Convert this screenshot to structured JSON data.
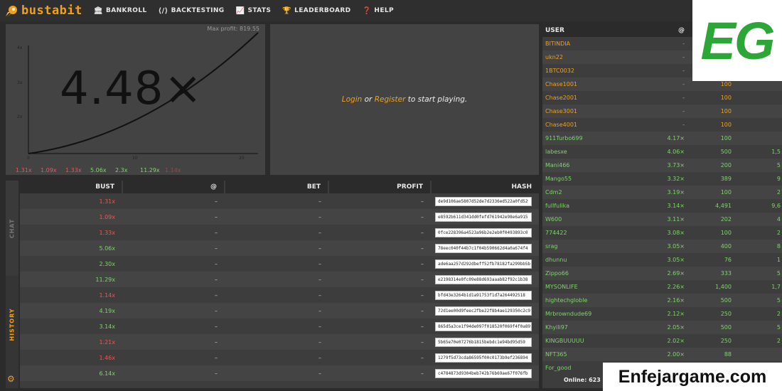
{
  "app": {
    "brand": "bustabit"
  },
  "nav": [
    {
      "label": "BANKROLL",
      "icon": "bank-icon"
    },
    {
      "label": "BACKTESTING",
      "icon": "code-icon"
    },
    {
      "label": "STATS",
      "icon": "chart-icon"
    },
    {
      "label": "LEADERBOARD",
      "icon": "trophy-icon"
    },
    {
      "label": "HELP",
      "icon": "help-icon"
    }
  ],
  "graph": {
    "max_profit": "Max profit: 819.55",
    "multiplier": "4.48×",
    "y_ticks": [
      "4x",
      "3x",
      "2x"
    ],
    "x_ticks": [
      "0",
      "10",
      "20"
    ],
    "recent_busts": [
      {
        "value": "1.31x",
        "color": "red"
      },
      {
        "value": "1.09x",
        "color": "red"
      },
      {
        "value": "1.33x",
        "color": "red"
      },
      {
        "value": "5.06x",
        "color": "green"
      },
      {
        "value": "2.3x",
        "color": "green"
      },
      {
        "value": "11.29x",
        "color": "green"
      },
      {
        "value": "1.14x",
        "color": "red"
      }
    ]
  },
  "play": {
    "login": "Login",
    "or": " or ",
    "register": "Register",
    "rest": " to start playing."
  },
  "side_tabs": {
    "chat": "CHAT",
    "history": "HISTORY"
  },
  "history": {
    "columns": [
      "BUST",
      "@",
      "BET",
      "PROFIT",
      "HASH"
    ],
    "rows": [
      {
        "bust": "1.31x",
        "color": "red",
        "at": "–",
        "bet": "–",
        "profit": "–",
        "hash": "de9d106ae5807d52de7d2336ed522a0fd52"
      },
      {
        "bust": "1.09x",
        "color": "red",
        "at": "–",
        "bet": "–",
        "profit": "–",
        "hash": "e8592b611d341dd0fefd761942e98e6a915"
      },
      {
        "bust": "1.33x",
        "color": "red",
        "at": "–",
        "bet": "–",
        "profit": "–",
        "hash": "0fce228396a4523a96b2e2eb0f0493893c0"
      },
      {
        "bust": "5.06x",
        "color": "green",
        "at": "–",
        "bet": "–",
        "profit": "–",
        "hash": "78eec040f44b7c1f04b590662d4a0a674f4"
      },
      {
        "bust": "2.30x",
        "color": "green",
        "at": "–",
        "bet": "–",
        "profit": "–",
        "hash": "ade6aa257d292dbeff52fb78182fa299bb5b"
      },
      {
        "bust": "11.29x",
        "color": "green",
        "at": "–",
        "bet": "–",
        "profit": "–",
        "hash": "e2198314e0fc09e88d693aaab82f92c1b38"
      },
      {
        "bust": "1.14x",
        "color": "red",
        "at": "–",
        "bet": "–",
        "profit": "–",
        "hash": "bfd43e3264b1d1a91753f1d7a264492518"
      },
      {
        "bust": "4.19x",
        "color": "green",
        "at": "–",
        "bet": "–",
        "profit": "–",
        "hash": "72d1ee00d9feec2fbe22f8b4ae129350c2c9"
      },
      {
        "bust": "3.14x",
        "color": "green",
        "at": "–",
        "bet": "–",
        "profit": "–",
        "hash": "865d5a3ce1f94de097f018520f069f4f0a89f"
      },
      {
        "bust": "1.21x",
        "color": "red",
        "at": "–",
        "bet": "–",
        "profit": "–",
        "hash": "5b65e70e07276b1815bebdc1e94bd95d59"
      },
      {
        "bust": "1.46x",
        "color": "red",
        "at": "–",
        "bet": "–",
        "profit": "–",
        "hash": "1279f5d73cda86595f00c0173b9ef236894"
      },
      {
        "bust": "6.14x",
        "color": "green",
        "at": "–",
        "bet": "–",
        "profit": "–",
        "hash": "c4784873d9304beb742b76b69ae67f076fb"
      }
    ]
  },
  "players": {
    "columns": [
      "USER",
      "@",
      "",
      ""
    ],
    "rows": [
      {
        "user": "BITINDIA",
        "at": "-",
        "bet": "",
        "profit": "",
        "color": "orange"
      },
      {
        "user": "ukn22",
        "at": "-",
        "bet": "",
        "profit": "",
        "color": "orange"
      },
      {
        "user": "1BTC0032",
        "at": "-",
        "bet": "",
        "profit": "",
        "color": "orange"
      },
      {
        "user": "Chase1001",
        "at": "-",
        "bet": "100",
        "profit": "",
        "color": "orange"
      },
      {
        "user": "Chase2001",
        "at": "-",
        "bet": "100",
        "profit": "",
        "color": "orange"
      },
      {
        "user": "Chase3001",
        "at": "-",
        "bet": "100",
        "profit": "",
        "color": "orange"
      },
      {
        "user": "Chase4001",
        "at": "-",
        "bet": "100",
        "profit": "",
        "color": "orange"
      },
      {
        "user": "911Turbo699",
        "at": "4.17×",
        "bet": "100",
        "profit": "",
        "color": "green"
      },
      {
        "user": "labesxe",
        "at": "4.06×",
        "bet": "500",
        "profit": "1,5",
        "color": "green"
      },
      {
        "user": "Mani466",
        "at": "3.73×",
        "bet": "200",
        "profit": "5",
        "color": "green"
      },
      {
        "user": "Mango55",
        "at": "3.32×",
        "bet": "389",
        "profit": "9",
        "color": "green"
      },
      {
        "user": "Cdm2",
        "at": "3.19×",
        "bet": "100",
        "profit": "2",
        "color": "green"
      },
      {
        "user": "fullfulika",
        "at": "3.14×",
        "bet": "4,491",
        "profit": "9,6",
        "color": "green"
      },
      {
        "user": "W600",
        "at": "3.11×",
        "bet": "202",
        "profit": "4",
        "color": "green"
      },
      {
        "user": "774422",
        "at": "3.08×",
        "bet": "100",
        "profit": "2",
        "color": "green"
      },
      {
        "user": "srag",
        "at": "3.05×",
        "bet": "400",
        "profit": "8",
        "color": "green"
      },
      {
        "user": "dhunnu",
        "at": "3.05×",
        "bet": "76",
        "profit": "1",
        "color": "green"
      },
      {
        "user": "Zippo66",
        "at": "2.69×",
        "bet": "333",
        "profit": "5",
        "color": "green"
      },
      {
        "user": "MYSONLIFE",
        "at": "2.26×",
        "bet": "1,400",
        "profit": "1,7",
        "color": "green"
      },
      {
        "user": "hightechgloble",
        "at": "2.16×",
        "bet": "500",
        "profit": "5",
        "color": "green"
      },
      {
        "user": "Mrbrowndude69",
        "at": "2.12×",
        "bet": "250",
        "profit": "2",
        "color": "green"
      },
      {
        "user": "Khyili97",
        "at": "2.05×",
        "bet": "500",
        "profit": "5",
        "color": "green"
      },
      {
        "user": "KINGBUUUUU",
        "at": "2.02×",
        "bet": "250",
        "profit": "2",
        "color": "green"
      },
      {
        "user": "NFT365",
        "at": "2.00×",
        "bet": "88",
        "profit": "",
        "color": "green"
      },
      {
        "user": "For_good",
        "at": "",
        "bet": "",
        "profit": "",
        "color": "green"
      }
    ]
  },
  "online": "Online: 623",
  "overlays": {
    "badge": "EG",
    "site": "Enfejargame.com"
  },
  "colors": {
    "accent": "#f0a11c",
    "red": "#e05a5a",
    "green": "#7fd46b"
  }
}
